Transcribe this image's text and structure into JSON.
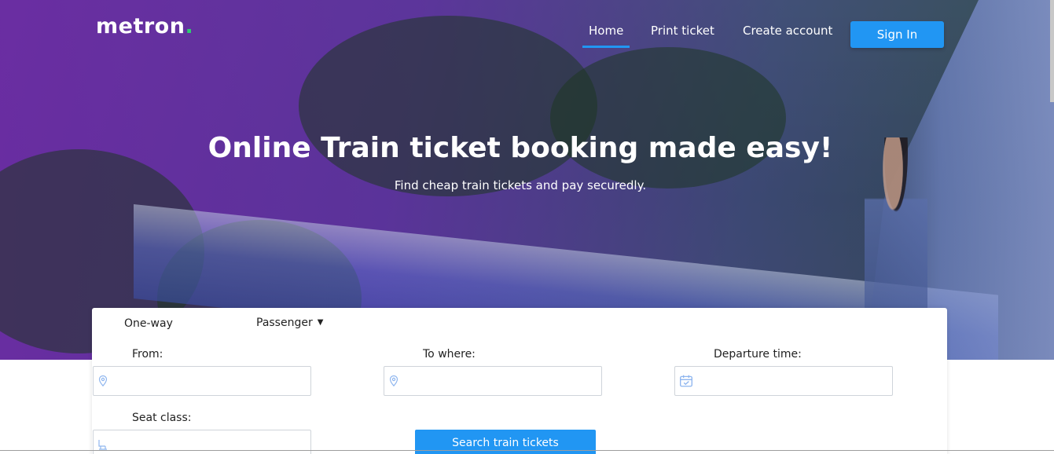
{
  "brand": {
    "name": "metron",
    "dot": "."
  },
  "nav": {
    "items": [
      {
        "label": "Home",
        "active": true
      },
      {
        "label": "Print ticket",
        "active": false
      },
      {
        "label": "Create account",
        "active": false
      }
    ],
    "signin_label": "Sign In"
  },
  "hero": {
    "title": "Online Train ticket booking made easy!",
    "subtitle": "Find cheap train tickets and pay securedly."
  },
  "search_form": {
    "trip_type": "One-way",
    "passenger_label": "Passenger",
    "from_label": "From:",
    "from_value": "",
    "to_label": "To where:",
    "to_value": "",
    "departure_label": "Departure time:",
    "departure_value": "",
    "seat_label": "Seat class:",
    "seat_value": "",
    "submit_label": "Search train tickets"
  },
  "icons": {
    "from": "location-pin-icon",
    "to": "location-pin-icon",
    "departure": "calendar-icon",
    "seat": "seat-icon",
    "passenger_caret": "caret-down-icon"
  },
  "colors": {
    "accent": "#2196f3",
    "hero_overlay": "#6e2aaa",
    "logo_dot": "#2ecc71",
    "icon": "#8fb6ef"
  }
}
